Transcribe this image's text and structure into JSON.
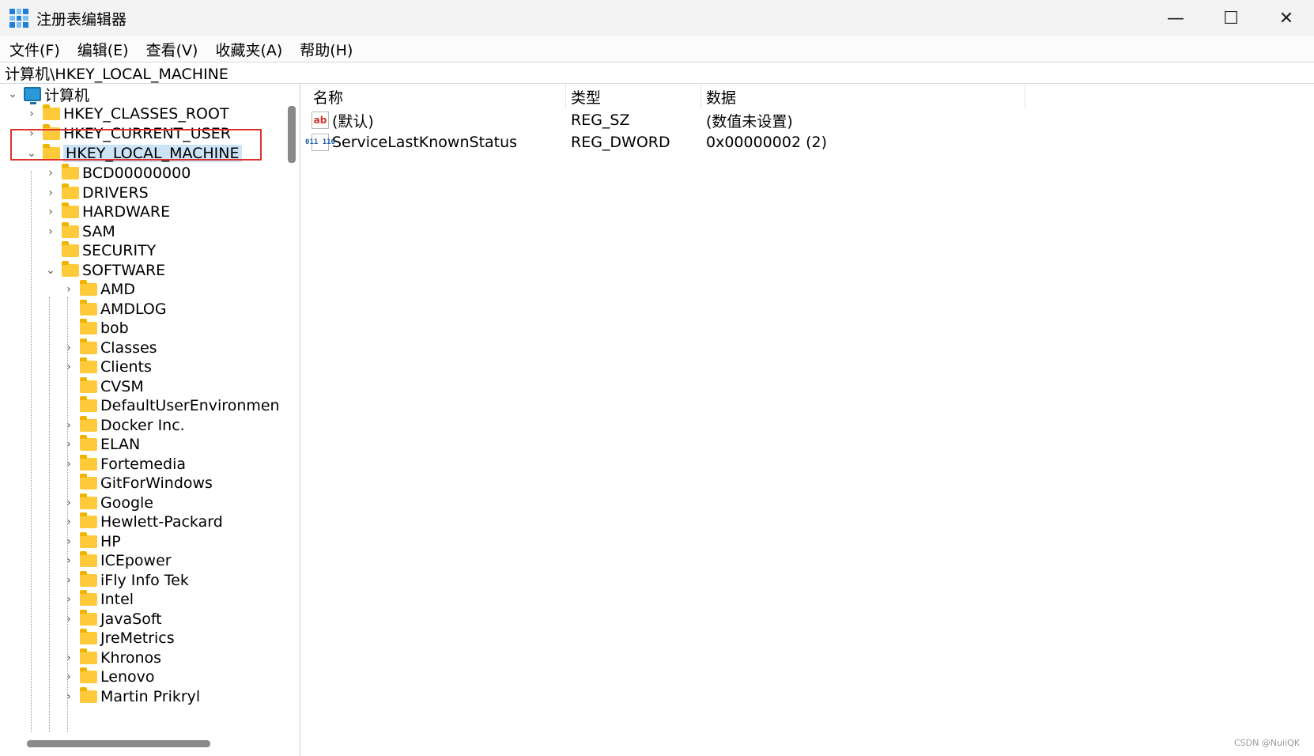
{
  "window": {
    "title": "注册表编辑器",
    "controls": {
      "minimize": "—",
      "maximize": "☐",
      "close": "✕"
    }
  },
  "menu": [
    {
      "label": "文件(F)"
    },
    {
      "label": "编辑(E)"
    },
    {
      "label": "查看(V)"
    },
    {
      "label": "收藏夹(A)"
    },
    {
      "label": "帮助(H)"
    }
  ],
  "address": "计算机\\HKEY_LOCAL_MACHINE",
  "tree": {
    "root": "计算机",
    "hives": [
      {
        "label": "HKEY_CLASSES_ROOT",
        "expanded": false
      },
      {
        "label": "HKEY_CURRENT_USER",
        "expanded": false
      },
      {
        "label": "HKEY_LOCAL_MACHINE",
        "expanded": true,
        "selected": true
      }
    ],
    "hklm_children": [
      {
        "label": "BCD00000000",
        "has_children": true
      },
      {
        "label": "DRIVERS",
        "has_children": true
      },
      {
        "label": "HARDWARE",
        "has_children": true
      },
      {
        "label": "SAM",
        "has_children": true
      },
      {
        "label": "SECURITY",
        "has_children": false
      },
      {
        "label": "SOFTWARE",
        "has_children": true,
        "expanded": true
      }
    ],
    "software_children": [
      {
        "label": "AMD",
        "has_children": true
      },
      {
        "label": "AMDLOG",
        "has_children": false
      },
      {
        "label": "bob",
        "has_children": false
      },
      {
        "label": "Classes",
        "has_children": true
      },
      {
        "label": "Clients",
        "has_children": true
      },
      {
        "label": "CVSM",
        "has_children": false
      },
      {
        "label": "DefaultUserEnvironment",
        "has_children": false
      },
      {
        "label": "Docker Inc.",
        "has_children": true
      },
      {
        "label": "ELAN",
        "has_children": true
      },
      {
        "label": "Fortemedia",
        "has_children": true
      },
      {
        "label": "GitForWindows",
        "has_children": false
      },
      {
        "label": "Google",
        "has_children": true
      },
      {
        "label": "Hewlett-Packard",
        "has_children": true
      },
      {
        "label": "HP",
        "has_children": true
      },
      {
        "label": "ICEpower",
        "has_children": true
      },
      {
        "label": "iFly Info Tek",
        "has_children": true
      },
      {
        "label": "Intel",
        "has_children": true
      },
      {
        "label": "JavaSoft",
        "has_children": true
      },
      {
        "label": "JreMetrics",
        "has_children": false
      },
      {
        "label": "Khronos",
        "has_children": true
      },
      {
        "label": "Lenovo",
        "has_children": true
      },
      {
        "label": "Martin Prikryl",
        "has_children": true
      }
    ]
  },
  "list": {
    "columns": [
      "名称",
      "类型",
      "数据"
    ],
    "rows": [
      {
        "icon": "string-value-icon",
        "name": "(默认)",
        "type": "REG_SZ",
        "data": "(数值未设置)"
      },
      {
        "icon": "binary-value-icon",
        "name": "ServiceLastKnownStatus",
        "type": "REG_DWORD",
        "data": "0x00000002 (2)"
      }
    ]
  },
  "icons": {
    "string_value": "ab",
    "dword_value": "011 110"
  },
  "watermark": "CSDN @NuiiQK",
  "colors": {
    "selection": "#cce4f7",
    "highlight_box": "#e0322c",
    "folder": "#ffca3a"
  }
}
